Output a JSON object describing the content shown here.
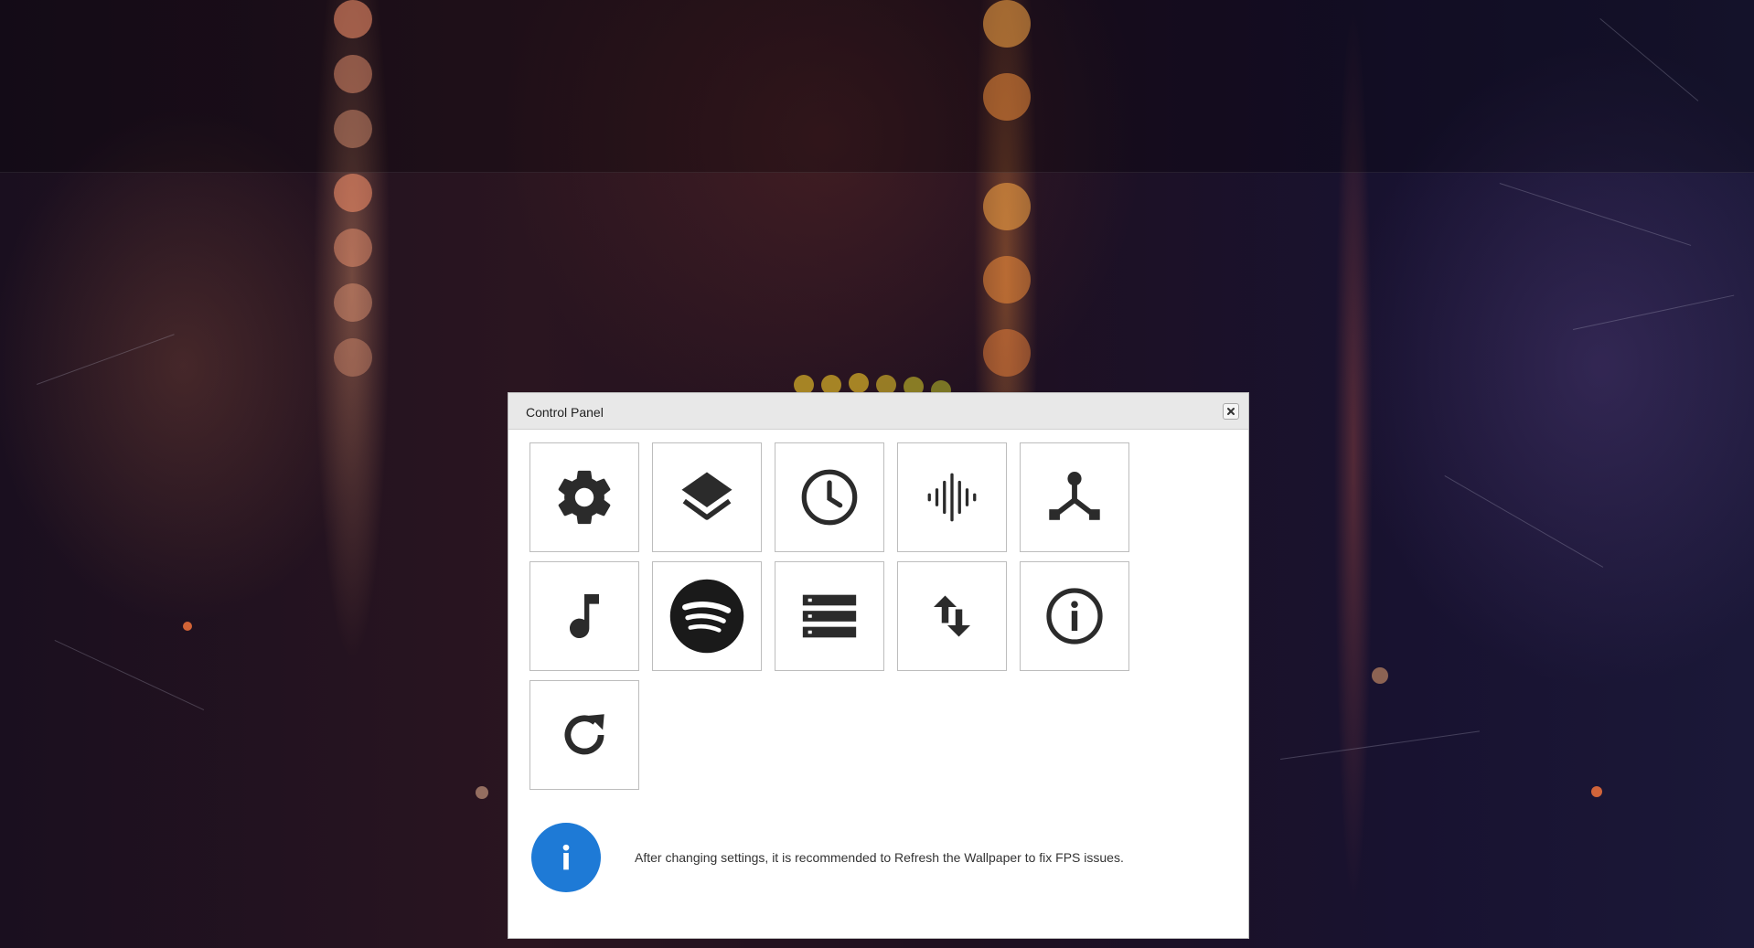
{
  "dialog": {
    "title": "Control Panel",
    "close_icon": "close-icon"
  },
  "tiles": [
    {
      "name": "settings",
      "icon": "gear-icon"
    },
    {
      "name": "layers",
      "icon": "layers-icon"
    },
    {
      "name": "clock",
      "icon": "clock-icon"
    },
    {
      "name": "audio-visualizer",
      "icon": "audio-wave-icon"
    },
    {
      "name": "network",
      "icon": "network-icon"
    },
    {
      "name": "music",
      "icon": "music-note-icon"
    },
    {
      "name": "spotify",
      "icon": "spotify-icon"
    },
    {
      "name": "list",
      "icon": "list-icon"
    },
    {
      "name": "sort",
      "icon": "sort-arrows-icon"
    },
    {
      "name": "info",
      "icon": "info-icon"
    },
    {
      "name": "refresh",
      "icon": "refresh-icon"
    }
  ],
  "notice": {
    "icon": "info-icon",
    "text": "After changing settings, it is recommended to Refresh the Wallpaper to fix FPS issues."
  },
  "colors": {
    "header_bg": "#e8e8e8",
    "icon": "#2b2b2b",
    "notice_blue": "#1e7ad6"
  }
}
